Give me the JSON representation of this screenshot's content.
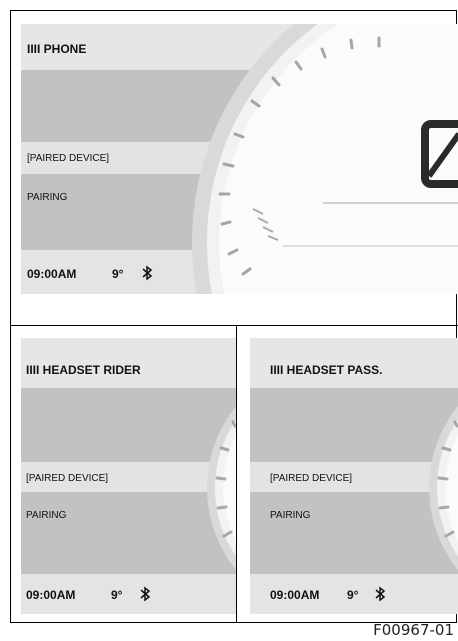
{
  "panels": {
    "phone": {
      "title": "IIII PHONE",
      "paired_device": "[PAIRED DEVICE]",
      "status": "PAIRING",
      "time": "09:00AM",
      "temperature": "9°",
      "bluetooth_icon": "bluetooth-icon"
    },
    "headset_rider": {
      "title": "IIII HEADSET RIDER",
      "paired_device": "[PAIRED DEVICE]",
      "status": "PAIRING",
      "time": "09:00AM",
      "temperature": "9°",
      "bluetooth_icon": "bluetooth-icon"
    },
    "headset_pass": {
      "title": "IIII HEADSET PASS.",
      "paired_device": "[PAIRED DEVICE]",
      "status": "PAIRING",
      "time": "09:00AM",
      "temperature": "9°",
      "bluetooth_icon": "bluetooth-icon"
    }
  },
  "figure_code": "F00967-01"
}
